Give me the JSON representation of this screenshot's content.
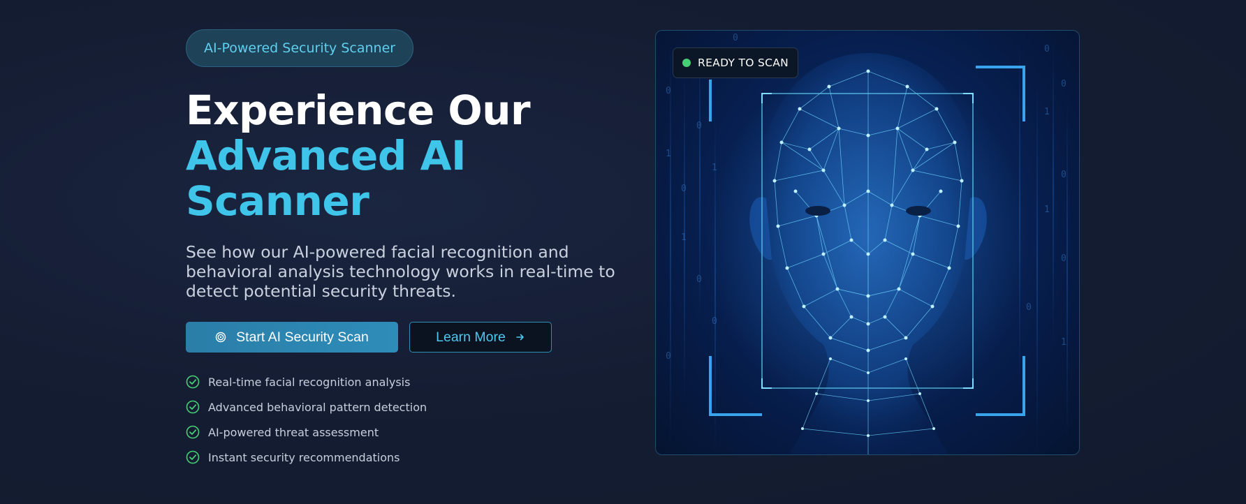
{
  "hero": {
    "badge": "AI-Powered Security Scanner",
    "headline_line1": "Experience Our",
    "headline_line2": "Advanced AI",
    "headline_line3": "Scanner",
    "description": "See how our AI-powered facial recognition and behavioral analysis technology works in real-time to detect potential security threats.",
    "primary_button": "Start AI Security Scan",
    "primary_icon": "target-icon",
    "secondary_button": "Learn More",
    "secondary_icon": "arrow-right-icon",
    "features": [
      "Real-time facial recognition analysis",
      "Advanced behavioral pattern detection",
      "AI-powered threat assessment",
      "Instant security recommendations"
    ],
    "feature_icon": "check-circle-icon"
  },
  "scanner": {
    "status_label": "READY TO SCAN",
    "status_icon": "status-dot-icon",
    "image": "face-mesh-scan-image"
  },
  "colors": {
    "accent": "#3fc4ea",
    "success": "#46cf74",
    "background": "#151d33"
  }
}
